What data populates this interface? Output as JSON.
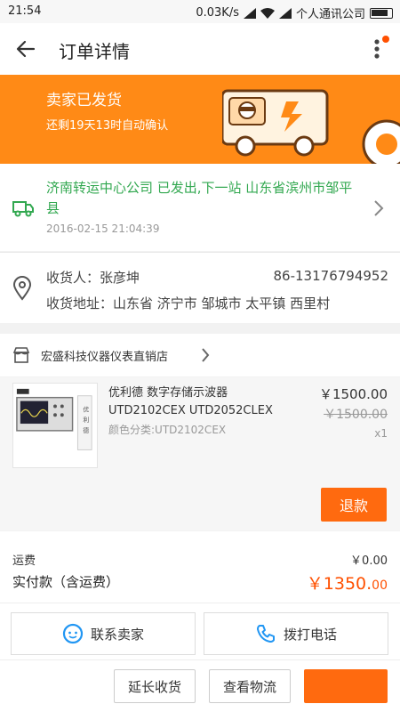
{
  "status_bar": {
    "time": "21:54",
    "speed": "0.03K/s",
    "carrier": "个人通讯公司"
  },
  "header": {
    "title": "订单详情"
  },
  "banner": {
    "status": "卖家已发货",
    "countdown": "还剩19天13时自动确认"
  },
  "logistics": {
    "message": "济南转运中心公司 已发出,下一站 山东省滨州市邹平县",
    "time": "2016-02-15 21:04:39"
  },
  "address": {
    "receiver_label": "收货人：张彦坤",
    "phone": "86-13176794952",
    "address_line": "收货地址：山东省 济宁市 邹城市 太平镇 西里村"
  },
  "shop": {
    "name": "宏盛科技仪器仪表直销店"
  },
  "item": {
    "title_line1": "优利德 数字存储示波器",
    "title_line2": "UTD2102CEX UTD2052CLEX",
    "variant": "颜色分类:UTD2102CEX",
    "price": "￥1500.00",
    "original_price": "￥1500.00",
    "quantity": "x1",
    "refund_label": "退款"
  },
  "totals": {
    "freight_label": "运费",
    "freight_value": "￥0.00",
    "paid_label": "实付款（含运费）",
    "paid_main": "￥1350.",
    "paid_cents": "00"
  },
  "contact": {
    "seller_label": "联系卖家",
    "call_label": "拨打电话"
  },
  "actions": {
    "extend_label": "延长收货",
    "logistics_label": "查看物流",
    "confirm_label": ""
  },
  "colors": {
    "accent": "#ff6a0f",
    "banner": "#ff8a16",
    "logistics_green": "#32a850",
    "price": "#ff5000"
  }
}
